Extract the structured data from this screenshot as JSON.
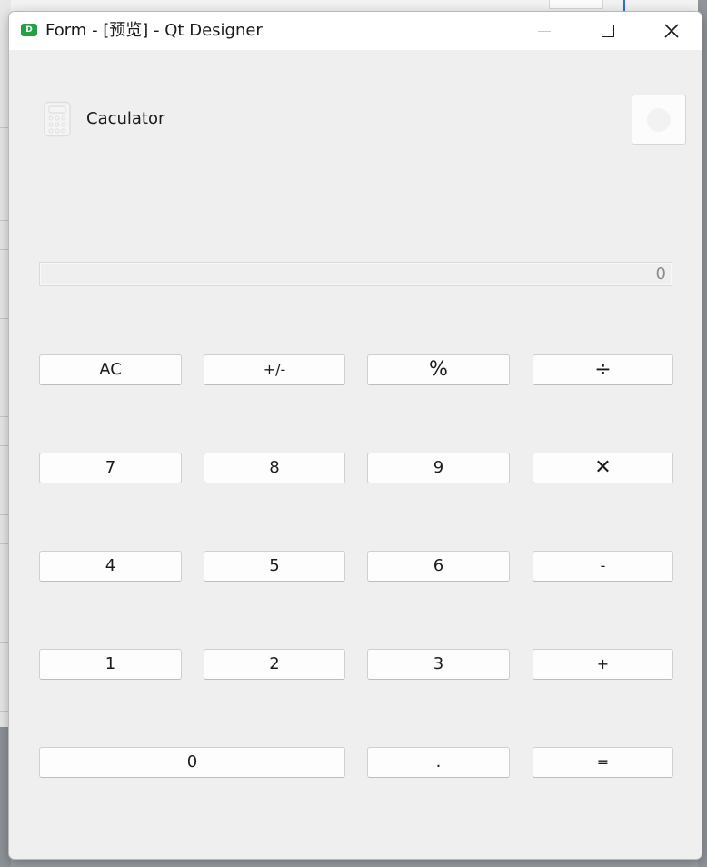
{
  "window": {
    "title": "Form - [预览] - Qt Designer",
    "app_icon_letter": "D",
    "app_icon_color": "#22a244"
  },
  "header": {
    "app_icon": "calculator-icon",
    "title": "Caculator",
    "settings_icon": "settings-icon"
  },
  "display": {
    "value": "0"
  },
  "keys": {
    "clear": "AC",
    "sign": "+/-",
    "percent": "%",
    "divide": "÷",
    "seven": "7",
    "eight": "8",
    "nine": "9",
    "multiply": "✕",
    "four": "4",
    "five": "5",
    "six": "6",
    "subtract": "-",
    "one": "1",
    "two": "2",
    "three": "3",
    "add": "+",
    "zero": "0",
    "decimal": ".",
    "equals": "="
  }
}
